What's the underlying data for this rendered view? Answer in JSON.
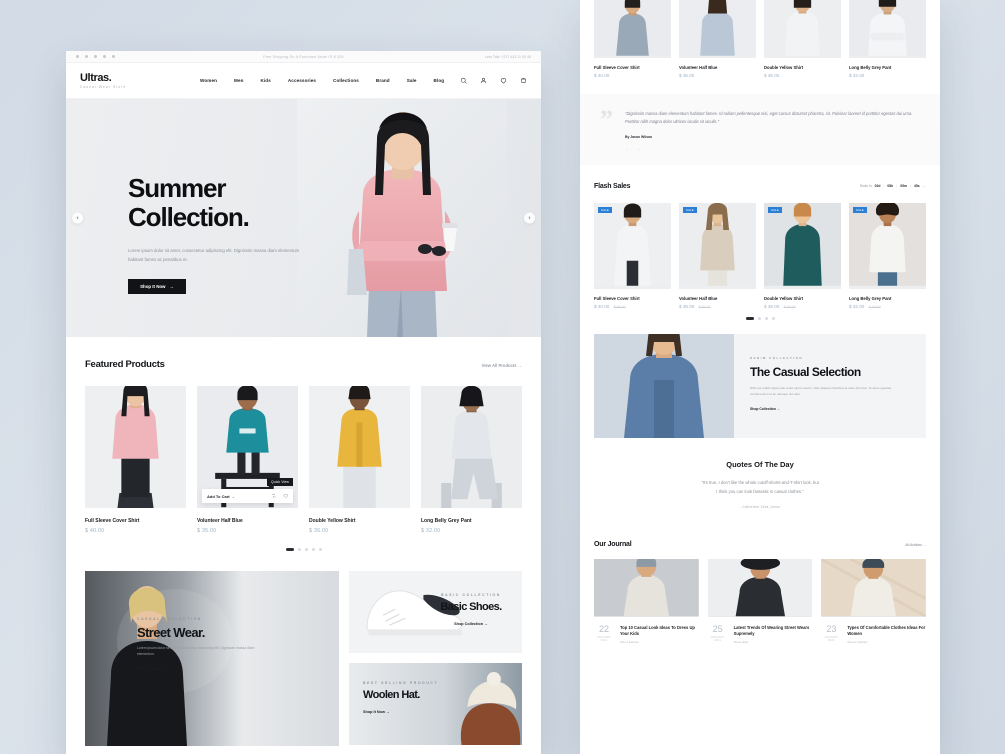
{
  "left": {
    "browser": {
      "announcement": "Free Shipping On A Purchase Value Of $ 200",
      "help": "Lets Talk! +237 433 11 00 46"
    },
    "logo": {
      "name": "Ultras.",
      "tagline": "Casual Wear Store"
    },
    "nav": [
      "Women",
      "Men",
      "Kids",
      "Accessories",
      "Collections",
      "Brand",
      "Sale",
      "Blog"
    ],
    "nav_icons": [
      "search-icon",
      "user-icon",
      "heart-icon",
      "cart-icon"
    ],
    "hero": {
      "title_line1": "Summer",
      "title_line2": "Collection.",
      "paragraph": "Lorem ipsum dolor sit amet, consectetur adipiscing elit. Dignissim massa diam elementum habitant fames ac penatibus et.",
      "button": "Shop It Now",
      "prev": "‹",
      "next": "›"
    },
    "featured": {
      "title": "Featured Products",
      "view_all": "View All Products",
      "hover": {
        "add_to_cart": "Add To Cart",
        "quick_view": "Quick View"
      },
      "products": [
        {
          "name": "Full Sleeve Cover Shirt",
          "price": "$ 40.00"
        },
        {
          "name": "Volunteer Half Blue",
          "price": "$ 35.00"
        },
        {
          "name": "Double Yellow Shirt",
          "price": "$ 36.00"
        },
        {
          "name": "Long Belly Grey Pant",
          "price": "$ 32.00"
        }
      ]
    },
    "collections": {
      "street": {
        "label": "CASUAL COLLECTION",
        "title": "Street Wear.",
        "paragraph": "Lorem ipsum dolor sit amet, consectetur adipiscing elit. Dignissim massa diam elementum.",
        "cta": "Shop Collection"
      },
      "shoes": {
        "label": "BASIC COLLECTION",
        "title": "Basic Shoes.",
        "cta": "Shop Collection"
      },
      "hat": {
        "label": "BEST SELLING PRODUCT",
        "title": "Woolen Hat.",
        "cta": "Shop It Now"
      }
    }
  },
  "right": {
    "top_products": [
      {
        "name": "Full Sleeve Cover Shirt",
        "price": "$ 40.00"
      },
      {
        "name": "Volunteer Half Blue",
        "price": "$ 35.00"
      },
      {
        "name": "Double Yellow Shirt",
        "price": "$ 36.00"
      },
      {
        "name": "Long Belly Grey Pant",
        "price": "$ 32.00"
      }
    ],
    "testimonial": {
      "quote_mark": "”",
      "text": "\"Dignissim massa diam elementum habitant fames. Id nullam pellentesque nisi, eget cursus dictumst pharetra, sit. Pulvinar laoreet id porttitor egestas dui urna. Porttitor nibh magna dolor ultrices iaculis sit iaculis.\"",
      "by": "By Jason Wilson",
      "nav": "←   →"
    },
    "flash": {
      "title": "Flash Sales",
      "timer_label": "Ends In",
      "days": "02d",
      "hours": "08h",
      "minutes": "05m",
      "seconds": "45s",
      "arrow": "→",
      "badge": "SALE",
      "products": [
        {
          "name": "Full Sleeve Cover Shirt",
          "price": "$ 40.00",
          "old": "$ 60.00"
        },
        {
          "name": "Volunteer Half Blue",
          "price": "$ 35.00",
          "old": "$ 50.00"
        },
        {
          "name": "Double Yellow Shirt",
          "price": "$ 36.00",
          "old": "$ 55.00"
        },
        {
          "name": "Long Belly Grey Pant",
          "price": "$ 32.00",
          "old": "$ 48.00"
        }
      ]
    },
    "denim": {
      "label": "DENIM COLLECTION",
      "title": "The Casual Selection",
      "paragraph": "Nibh est mattis ligula odio amet turpis mauris. Odio aliquam faucibus at vitae elit risus. Tempus egestas condimentum id ac natoque dui odio.",
      "cta": "Shop Collection"
    },
    "quotes": {
      "title": "Quotes Of The Day",
      "line1": "\"It's true, I don't like the whole cutoff-shorts-and-T-shirt look, but",
      "line2": "I think you can look fantastic in casual clothes.\"",
      "author": "- Catherine Zeta-Jones"
    },
    "journal": {
      "title": "Our Journal",
      "view_all": "All Articles",
      "posts": [
        {
          "day": "22",
          "month": "JANUARY 2021",
          "title": "Top 10 Casual Look Ideas To Dress Up Your Kids",
          "sub": "Kids & Fashion"
        },
        {
          "day": "25",
          "month": "JANUARY 2021",
          "title": "Latest Trends Of Wearing Street Wears Supremely",
          "sub": "Street Wear"
        },
        {
          "day": "23",
          "month": "JANUARY 2021",
          "title": "Types Of Comfortable Clothes Ideas For Women",
          "sub": "Women Fashion"
        }
      ]
    }
  }
}
